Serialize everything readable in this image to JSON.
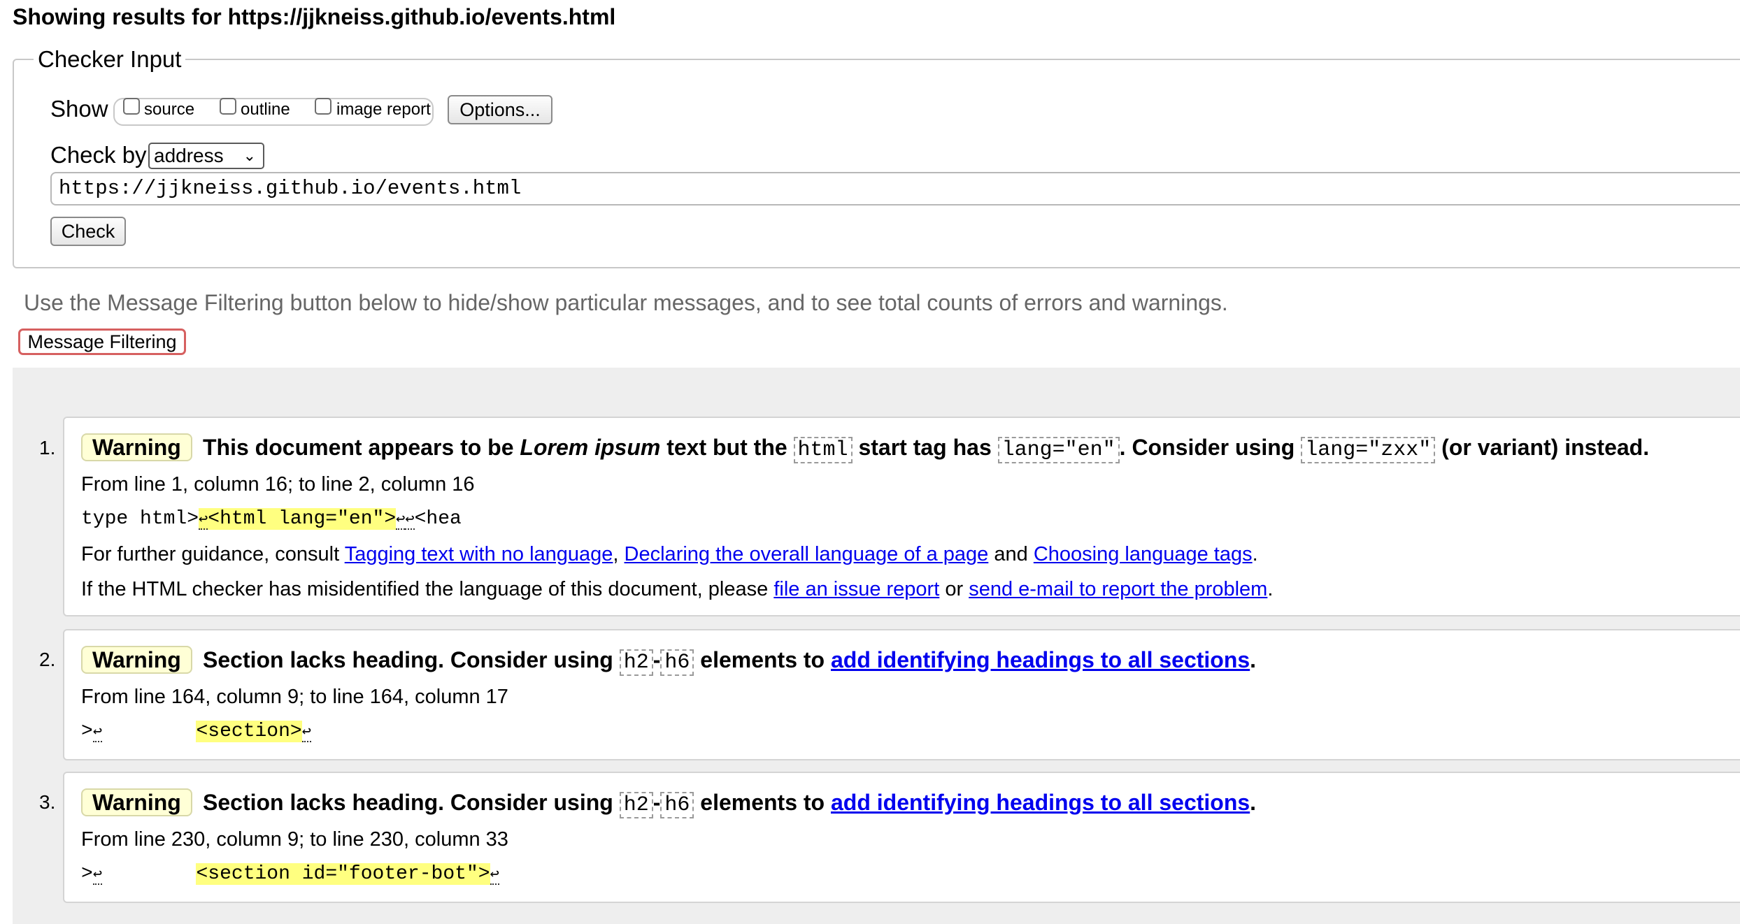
{
  "title": "Showing results for https://jjkneiss.github.io/events.html",
  "checker_input": {
    "legend": "Checker Input",
    "show_label": "Show",
    "checkboxes": [
      {
        "label": "source",
        "checked": false
      },
      {
        "label": "outline",
        "checked": false
      },
      {
        "label": "image report",
        "checked": false
      }
    ],
    "options_button": "Options...",
    "check_by_label": "Check by",
    "check_by_value": "address",
    "url_value": "https://jjkneiss.github.io/events.html",
    "check_button": "Check"
  },
  "filter_hint": "Use the Message Filtering button below to hide/show particular messages, and to see total counts of errors and warnings.",
  "message_filtering_button": "Message Filtering",
  "messages": [
    {
      "number": "1.",
      "type": "Warning",
      "text_parts": {
        "a": "This document appears to be ",
        "b": "Lorem ipsum",
        "c": " text but the ",
        "code1": "html",
        "d": " start tag has ",
        "code2": "lang=\"en\"",
        "e": ". Consider using ",
        "code3": "lang=\"zxx\"",
        "f": " (or variant) instead."
      },
      "location": "From line 1, column 16; to line 2, column 16",
      "extract_before": "type html>",
      "extract_highlight": "<html lang=\"en\">",
      "extract_after": "<hea",
      "guidance": {
        "prefix": "For further guidance, consult ",
        "link1": "Tagging text with no language",
        "sep1": ", ",
        "link2": "Declaring the overall language of a page",
        "sep2": " and ",
        "link3": "Choosing language tags",
        "suffix": "."
      },
      "misidentified": {
        "prefix": "If the HTML checker has misidentified the language of this document, please ",
        "link1": "file an issue report",
        "sep": " or ",
        "link2": "send e-mail to report the problem",
        "suffix": "."
      }
    },
    {
      "number": "2.",
      "type": "Warning",
      "text_parts": {
        "a": "Section lacks heading. Consider using ",
        "code1": "h2",
        "dash": "-",
        "code2": "h6",
        "b": " elements to ",
        "link": "add identifying headings to all sections",
        "c": "."
      },
      "location": "From line 164, column 9; to line 164, column 17",
      "extract_before": ">",
      "extract_highlight": "<section>",
      "extract_after": ""
    },
    {
      "number": "3.",
      "type": "Warning",
      "text_parts": {
        "a": "Section lacks heading. Consider using ",
        "code1": "h2",
        "dash": "-",
        "code2": "h6",
        "b": " elements to ",
        "link": "add identifying headings to all sections",
        "c": "."
      },
      "location": "From line 230, column 9; to line 230, column 33",
      "extract_before": ">",
      "extract_highlight": "<section id=\"footer-bot\">",
      "extract_after": ""
    }
  ],
  "colors": {
    "warning_badge_bg": "#ffffd6",
    "highlight": "#ffff80",
    "link": "#0000ee",
    "filter_button_border": "#d66060",
    "results_bg": "#eeeeee"
  },
  "icons": {
    "return": "↩",
    "select_chevron": "⌄"
  }
}
